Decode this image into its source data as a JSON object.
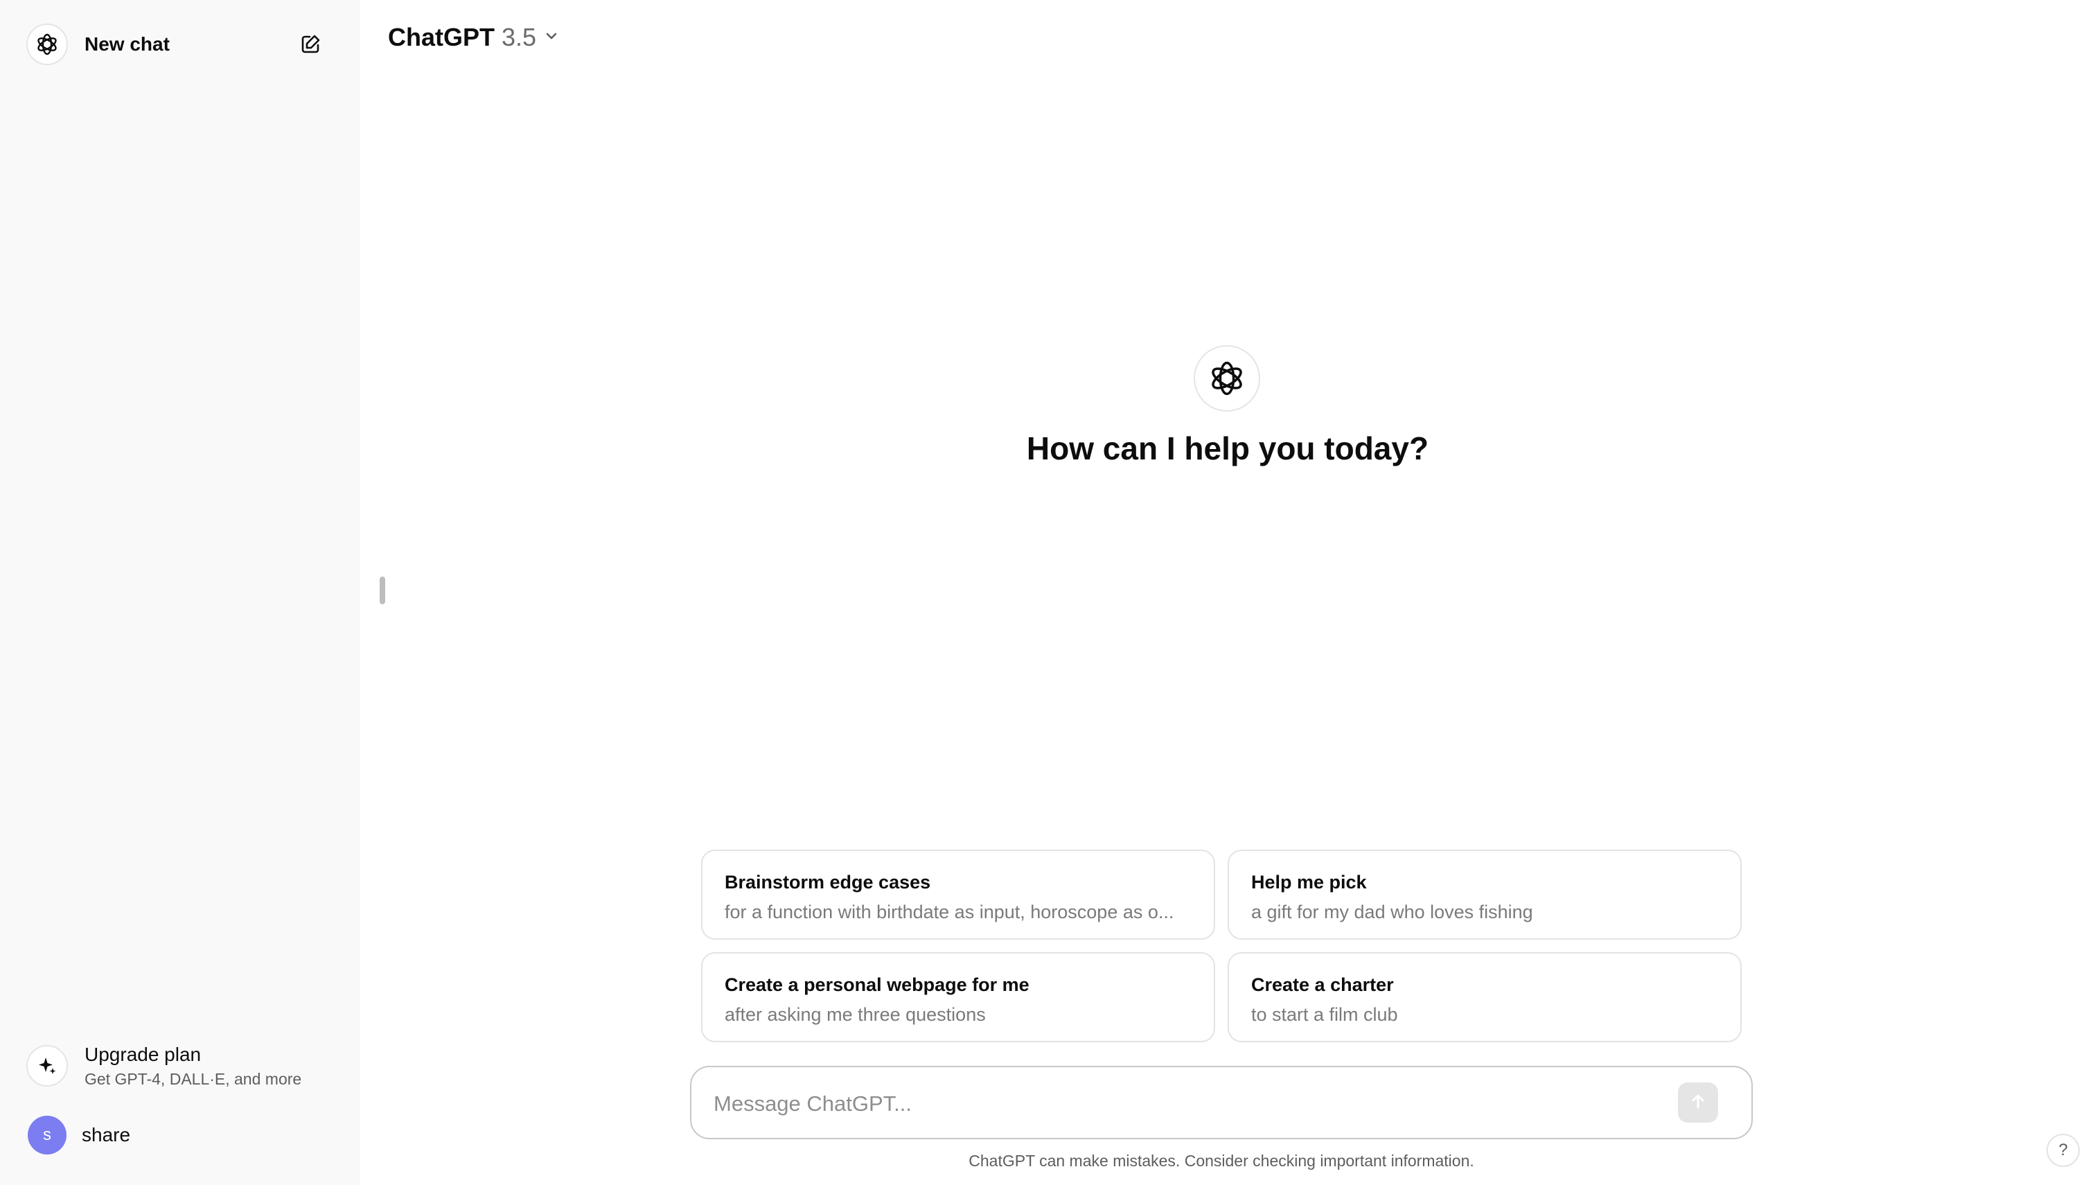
{
  "sidebar": {
    "new_chat_label": "New chat",
    "upgrade_title": "Upgrade plan",
    "upgrade_subtitle": "Get GPT-4, DALL·E, and more",
    "user_initial": "s",
    "user_name": "share"
  },
  "header": {
    "model_name": "ChatGPT",
    "model_version": "3.5"
  },
  "main": {
    "hero_title": "How can I help you today?",
    "suggestions": [
      {
        "title": "Brainstorm edge cases",
        "subtitle": "for a function with birthdate as input, horoscope as o..."
      },
      {
        "title": "Help me pick",
        "subtitle": "a gift for my dad who loves fishing"
      },
      {
        "title": "Create a personal webpage for me",
        "subtitle": "after asking me three questions"
      },
      {
        "title": "Create a charter",
        "subtitle": "to start a film club"
      }
    ],
    "composer_placeholder": "Message ChatGPT...",
    "disclaimer": "ChatGPT can make mistakes. Consider checking important information.",
    "help_label": "?"
  },
  "colors": {
    "sidebar_bg": "#f9f9f9",
    "avatar_bg": "#7b7df0",
    "send_disabled_bg": "#e5e5e5"
  },
  "icons": [
    "openai-logo-icon",
    "edit-icon",
    "sparkle-icon",
    "chevron-down-icon",
    "arrow-up-icon",
    "help-icon"
  ]
}
